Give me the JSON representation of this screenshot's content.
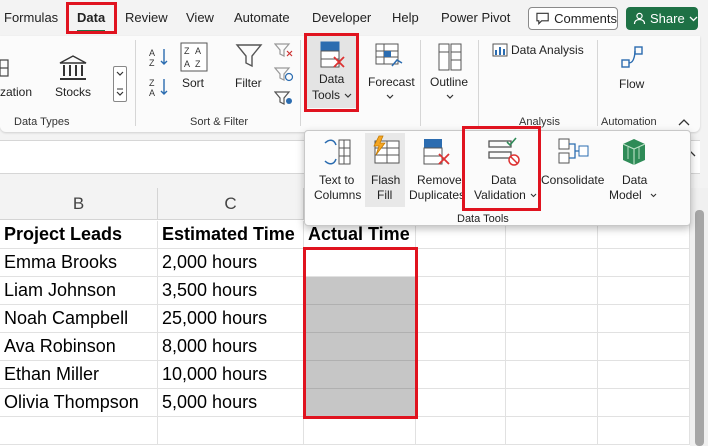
{
  "tabs": {
    "formulas": "Formulas",
    "data": "Data",
    "review": "Review",
    "view": "View",
    "automate": "Automate",
    "developer": "Developer",
    "help": "Help",
    "power_pivot": "Power Pivot"
  },
  "header_buttons": {
    "comments": "Comments",
    "share": "Share"
  },
  "ribbon": {
    "zation": "zation",
    "stocks": "Stocks",
    "data_types": "Data Types",
    "sort": "Sort",
    "filter": "Filter",
    "sort_filter": "Sort & Filter",
    "data_tools_line1": "Data",
    "data_tools_line2": "Tools",
    "forecast": "Forecast",
    "outline": "Outline",
    "data_analysis": "Data Analysis",
    "analysis": "Analysis",
    "flow": "Flow",
    "automation": "Automation"
  },
  "data_tools_menu": {
    "text_to_columns_1": "Text to",
    "text_to_columns_2": "Columns",
    "flash_fill_1": "Flash",
    "flash_fill_2": "Fill",
    "remove_duplicates_1": "Remove",
    "remove_duplicates_2": "Duplicates",
    "data_validation_1": "Data",
    "data_validation_2": "Validation",
    "consolidate": "Consolidate",
    "data_model_1": "Data",
    "data_model_2": "Model",
    "group_label": "Data Tools"
  },
  "sheet": {
    "columns": [
      "B",
      "C"
    ],
    "headers": [
      "Project Leads",
      "Estimated Time",
      "Actual Time"
    ],
    "rows": [
      [
        "Emma Brooks",
        "2,000 hours",
        ""
      ],
      [
        "Liam Johnson",
        "3,500 hours",
        ""
      ],
      [
        "Noah Campbell",
        "25,000 hours",
        ""
      ],
      [
        "Ava Robinson",
        "8,000 hours",
        ""
      ],
      [
        "Ethan Miller",
        "10,000 hours",
        ""
      ],
      [
        "Olivia Thompson",
        "5,000 hours",
        ""
      ]
    ]
  },
  "colors": {
    "accent_green": "#217346",
    "share_green": "#1e7145",
    "highlight_red": "#e0131f",
    "selected_fill": "#c6c6c6"
  },
  "icons": [
    "comment-icon",
    "chevron-down-icon",
    "bank-icon",
    "sort-az-icon",
    "sort-za-icon",
    "sort-icon",
    "filter-icon",
    "clear-filter-icon",
    "reapply-filter-icon",
    "advanced-filter-icon",
    "data-tools-icon",
    "forecast-icon",
    "outline-icon",
    "data-analysis-icon",
    "flow-icon",
    "collapse-ribbon-icon",
    "text-to-columns-icon",
    "flash-fill-icon",
    "remove-duplicates-icon",
    "data-validation-icon",
    "consolidate-icon",
    "data-model-icon"
  ]
}
